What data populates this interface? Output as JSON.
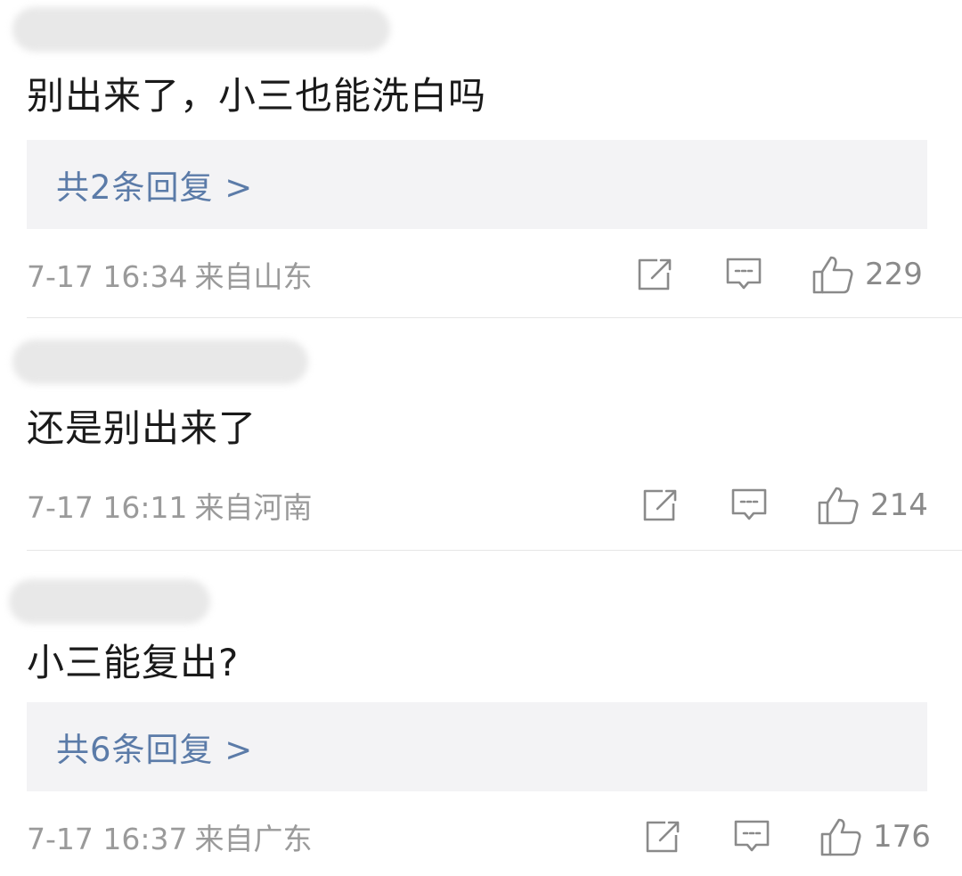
{
  "comments": [
    {
      "text": "别出来了，小三也能洗白吗",
      "replies_label": "共2条回复 >",
      "time": "7-17 16:34",
      "location": "来自山东",
      "likes": "229"
    },
    {
      "text": "还是别出来了",
      "time": "7-17 16:11",
      "location": "来自河南",
      "likes": "214"
    },
    {
      "text": "小三能复出?",
      "replies_label": "共6条回复 >",
      "time": "7-17 16:37",
      "location": "来自广东",
      "likes": "176"
    }
  ],
  "icons": {
    "share": "share-icon",
    "reply": "comment-icon",
    "like": "thumbs-up-icon"
  },
  "colors": {
    "reply_link": "#5b7ba8",
    "reply_box_bg": "#f3f3f5",
    "meta_text": "#9a9a9a",
    "divider": "#e6e6e6"
  }
}
